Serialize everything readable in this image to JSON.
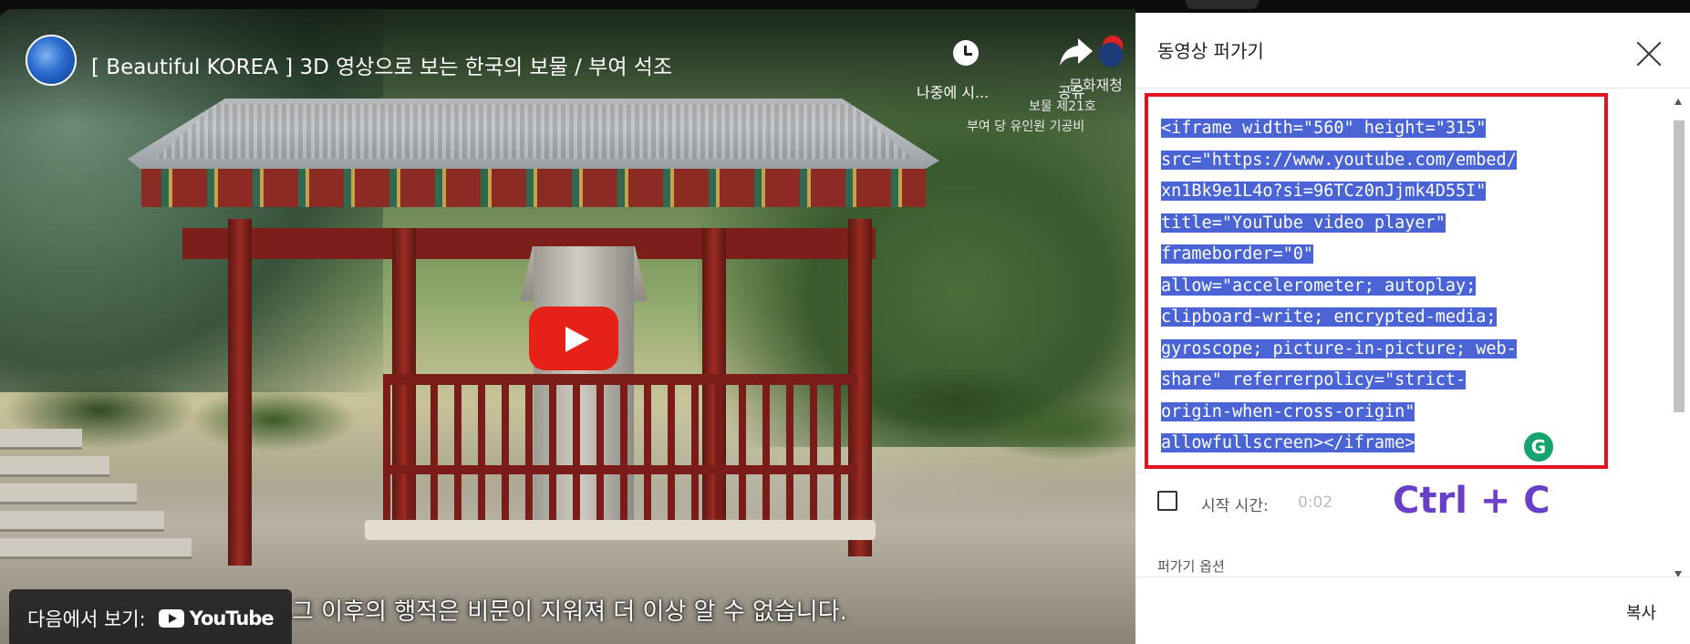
{
  "video": {
    "title": "[ Beautiful KOREA ] 3D 영상으로 보는 한국의 보물 / 부여 석조",
    "watch_later_label": "나중에 시...",
    "share_label": "공유",
    "watermark_org": "문화재청",
    "watermark_line1": "보물 제21호",
    "watermark_line2": "부여 당 유인원 기공비",
    "subtitle": "그 이후의 행적은 비문이 지워져 더 이상 알 수 없습니다.",
    "watch_on_label": "다음에서 보기:",
    "youtube_wordmark": "YouTube"
  },
  "embed_dialog": {
    "title": "동영상 퍼가기",
    "code_lines": [
      "<iframe width=\"560\" height=\"315\"",
      "src=\"https://www.youtube.com/embed/",
      "xn1Bk9e1L4o?si=96TCz0nJjmk4D55I\"",
      "title=\"YouTube video player\"",
      "frameborder=\"0\"",
      "allow=\"accelerometer; autoplay;",
      "clipboard-write; encrypted-media;",
      "gyroscope; picture-in-picture; web-",
      "share\" referrerpolicy=\"strict-",
      "origin-when-cross-origin\"",
      "allowfullscreen></iframe>"
    ],
    "grammarly_badge": "G",
    "start_time_label": "시작 시간:",
    "start_time_value": "0:02",
    "annotation": "Ctrl + C",
    "options_label": "퍼가기 옵션",
    "copy_button": "복사"
  },
  "colors": {
    "highlight": "#4a64d6",
    "annotation_box": "#e8101f",
    "annotation_text": "#6a3fc9",
    "play_button": "#e62117"
  }
}
